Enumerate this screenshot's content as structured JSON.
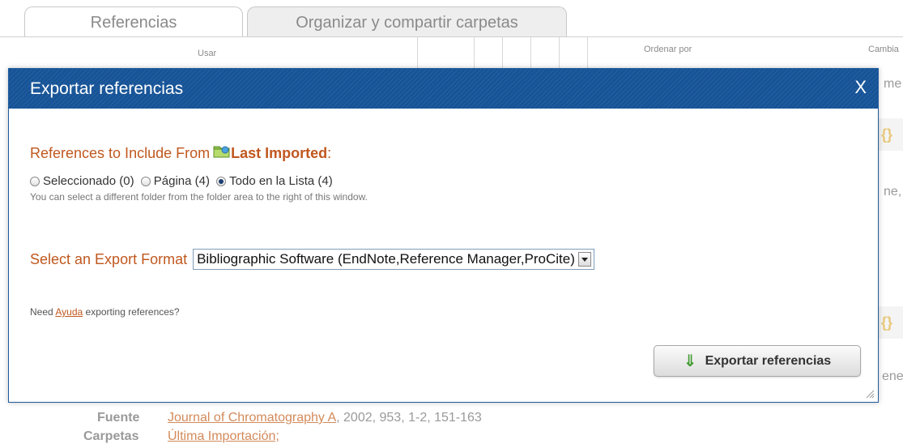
{
  "background": {
    "tabs": [
      {
        "label": "Referencias"
      },
      {
        "label": "Organizar y compartir carpetas"
      }
    ],
    "toolbar": {
      "use_label": "Usar",
      "sort_label": "Ordenar por",
      "change_label": "Cambia"
    },
    "edge_fragments": [
      "me",
      "ne,",
      "ene"
    ],
    "record": {
      "source_label": "Fuente",
      "source_link": "Journal of Chromatography A",
      "source_details": ", 2002, 953, 1-2, 151-163",
      "folders_label": "Carpetas",
      "folders_value": "Última Importación;"
    }
  },
  "modal": {
    "title": "Exportar referencias",
    "close_label": "X",
    "include_heading": "References to Include From",
    "folder_name": "Last Imported",
    "colon": ":",
    "radios": [
      {
        "label": "Seleccionado (0)",
        "checked": false
      },
      {
        "label": "Página (4)",
        "checked": false
      },
      {
        "label": "Todo en la Lista (4)",
        "checked": true
      }
    ],
    "hint": "You can select a different folder from the folder area to the right of this window.",
    "format_label": "Select an Export Format",
    "format_selected": "Bibliographic Software (EndNote,Reference Manager,ProCite)",
    "help_prefix": "Need",
    "help_link": "Ayuda",
    "help_suffix": "exporting references?",
    "export_button": "Exportar referencias"
  },
  "colors": {
    "header_blue": "#165397",
    "accent_orange": "#c0581f",
    "export_arrow_green": "#3d9a2c"
  },
  "icons": [
    "folder-icon",
    "close-icon",
    "down-arrow-icon",
    "chevron-down-icon",
    "resize-grip-icon"
  ]
}
